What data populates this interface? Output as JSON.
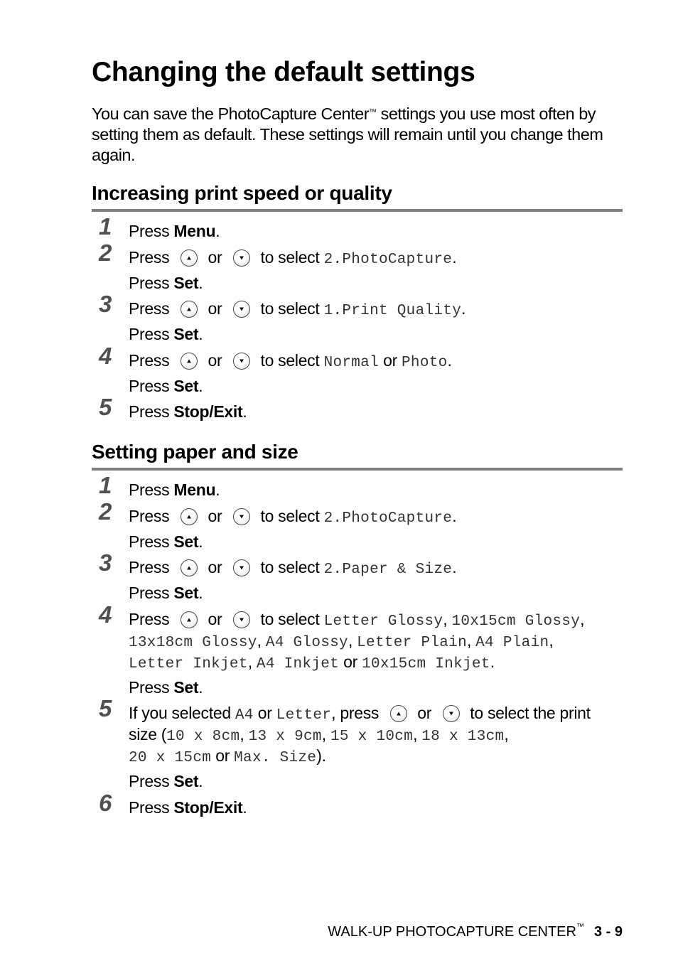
{
  "title": "Changing the default settings",
  "intro": {
    "before_tm": "You can save the PhotoCapture Center",
    "tm": "™",
    "after_tm": " settings you use most often by setting them as default. These settings will remain until you change them again."
  },
  "common": {
    "press": "Press ",
    "or": " or ",
    "to_select": " to select ",
    "period": ".",
    "comma": ", ",
    "up_icon": "up-arrow-button",
    "down_icon": "down-arrow-button"
  },
  "section1": {
    "heading": "Increasing print speed or quality",
    "steps": [
      {
        "num": "1",
        "key": "Menu"
      },
      {
        "num": "2",
        "value": "2.PhotoCapture",
        "then_key": "Set"
      },
      {
        "num": "3",
        "value": "1.Print Quality",
        "then_key": "Set"
      },
      {
        "num": "4",
        "value_a": "Normal",
        "value_b": "Photo",
        "then_key": "Set"
      },
      {
        "num": "5",
        "key": "Stop/Exit"
      }
    ]
  },
  "section2": {
    "heading": "Setting paper and size",
    "steps": [
      {
        "num": "1",
        "key": "Menu"
      },
      {
        "num": "2",
        "value": "2.PhotoCapture",
        "then_key": "Set"
      },
      {
        "num": "3",
        "value": "2.Paper & Size",
        "then_key": "Set"
      },
      {
        "num": "4",
        "options": [
          "Letter Glossy",
          "10x15cm Glossy",
          "13x18cm Glossy",
          "A4 Glossy",
          "Letter Plain",
          "A4 Plain",
          "Letter Inkjet",
          "A4 Inkjet",
          "10x15cm Inkjet"
        ],
        "then_key": "Set"
      },
      {
        "num": "5",
        "intro": "If you selected ",
        "a4": "A4",
        "letter": "Letter",
        "press": ", press ",
        "select_print": " to select the print",
        "size_open": "size (",
        "sizes": [
          "10 x 8cm",
          "13 x 9cm",
          "15 x 10cm",
          "18 x 13cm",
          "20 x 15cm",
          "Max. Size"
        ],
        "size_close": ").",
        "then_key": "Set"
      },
      {
        "num": "6",
        "key": "Stop/Exit"
      }
    ]
  },
  "footer": {
    "label": "WALK-UP PHOTOCAPTURE CENTER",
    "tm": "™",
    "page": "3 - 9"
  }
}
